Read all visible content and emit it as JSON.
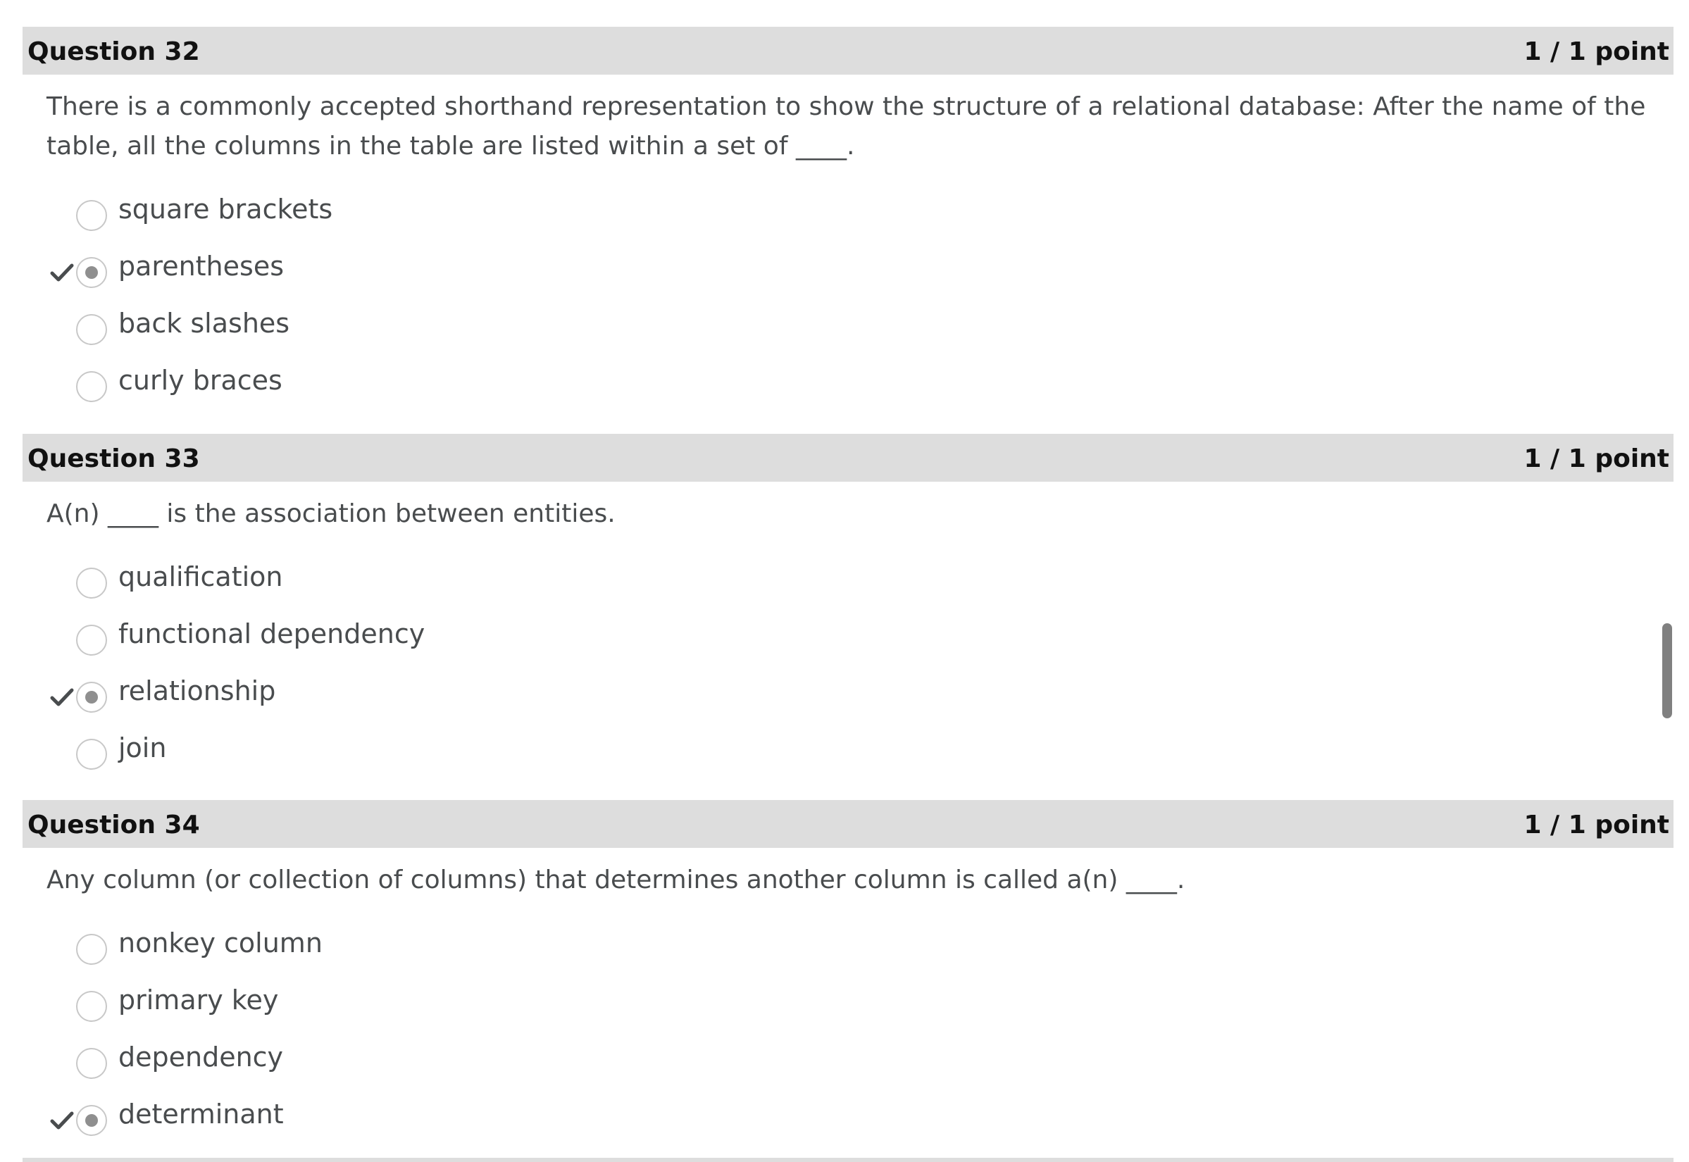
{
  "questions": [
    {
      "title": "Question 32",
      "points": "1 / 1 point",
      "prompt": "There is a commonly accepted shorthand representation to show the structure of a relational database: After the name of the table, all the columns in the table are listed within a set of ____.",
      "options": [
        {
          "label": "square brackets",
          "selected": false,
          "correct_mark": false
        },
        {
          "label": "parentheses",
          "selected": true,
          "correct_mark": true
        },
        {
          "label": "back slashes",
          "selected": false,
          "correct_mark": false
        },
        {
          "label": "curly braces",
          "selected": false,
          "correct_mark": false
        }
      ]
    },
    {
      "title": "Question 33",
      "points": "1 / 1 point",
      "prompt": "A(n) ____ is the association between entities.",
      "options": [
        {
          "label": "qualification",
          "selected": false,
          "correct_mark": false
        },
        {
          "label": "functional dependency",
          "selected": false,
          "correct_mark": false
        },
        {
          "label": "relationship",
          "selected": true,
          "correct_mark": true
        },
        {
          "label": "join",
          "selected": false,
          "correct_mark": false
        }
      ]
    },
    {
      "title": "Question 34",
      "points": "1 / 1 point",
      "prompt": "Any column (or collection of columns) that determines another column is called a(n) ____.",
      "options": [
        {
          "label": "nonkey column",
          "selected": false,
          "correct_mark": false
        },
        {
          "label": "primary key",
          "selected": false,
          "correct_mark": false
        },
        {
          "label": "dependency",
          "selected": false,
          "correct_mark": false
        },
        {
          "label": "determinant",
          "selected": true,
          "correct_mark": true
        }
      ]
    }
  ],
  "icons": {
    "check": "checkmark-icon",
    "radio": "radio-button"
  },
  "colors": {
    "header_bg": "#dddddd",
    "text": "#494c4e",
    "title_text": "#111111",
    "check": "#494c4e",
    "radio_dot": "#8f8f8f",
    "radio_border": "#c8c8c8",
    "scrollbar": "#808080"
  }
}
